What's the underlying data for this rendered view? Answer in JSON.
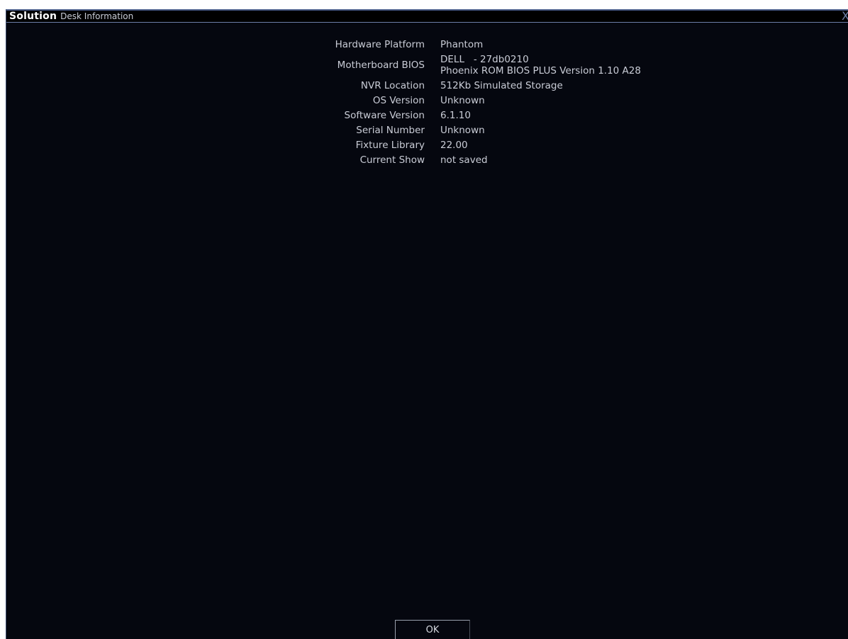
{
  "window": {
    "brand": "Solution",
    "title": "Desk Information",
    "close_glyph": "X"
  },
  "info": {
    "rows": [
      {
        "label": "Hardware Platform",
        "value": "Phantom"
      },
      {
        "label": "Motherboard BIOS",
        "value_lines": [
          "DELL   - 27db0210",
          "Phoenix ROM BIOS PLUS Version 1.10 A28"
        ]
      },
      {
        "label": "NVR Location",
        "value": "512Kb Simulated Storage"
      },
      {
        "label": "OS Version",
        "value": "Unknown"
      },
      {
        "label": "Software Version",
        "value": "6.1.10"
      },
      {
        "label": "Serial Number",
        "value": "Unknown"
      },
      {
        "label": "Fixture Library",
        "value": "22.00"
      },
      {
        "label": "Current Show",
        "value": "not saved"
      }
    ]
  },
  "footer": {
    "ok_label": "OK"
  },
  "colors": {
    "background": "#05070f",
    "text": "#c9ccd6",
    "accent": "#6d7fa8"
  }
}
